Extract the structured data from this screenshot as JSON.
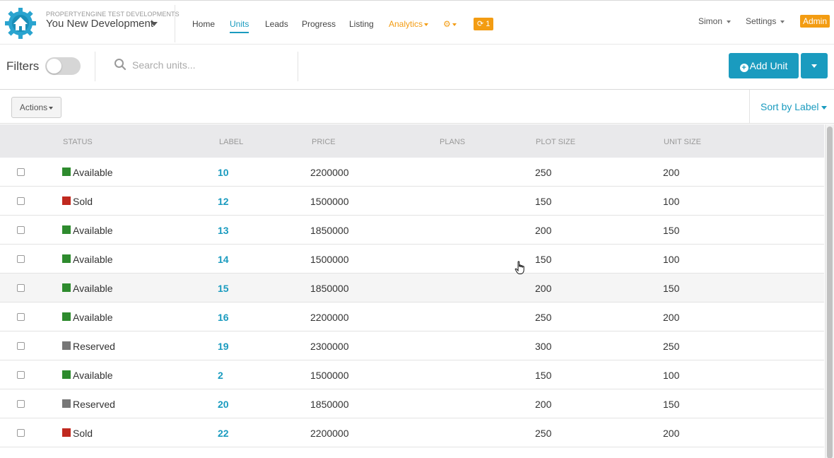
{
  "brand": {
    "subtitle": "PROPERTYENGINE TEST DEVELOPMENTS",
    "title": "You New Development"
  },
  "nav": {
    "items": [
      {
        "label": "Home"
      },
      {
        "label": "Units"
      },
      {
        "label": "Leads"
      },
      {
        "label": "Progress"
      },
      {
        "label": "Listing"
      }
    ],
    "analytics": "Analytics",
    "sync_count": "1",
    "user": "Simon",
    "settings": "Settings",
    "admin": "Admin"
  },
  "filters": {
    "label": "Filters",
    "search_placeholder": "Search units...",
    "add_unit": "Add Unit"
  },
  "toolbar": {
    "actions": "Actions",
    "sort": "Sort by Label"
  },
  "table": {
    "headers": [
      "STATUS",
      "LABEL",
      "PRICE",
      "PLANS",
      "PLOT SIZE",
      "UNIT SIZE"
    ],
    "rows": [
      {
        "status": "Available",
        "color": "#2e8b2e",
        "label": "10",
        "price": "2200000",
        "plans": "",
        "plot": "250",
        "unit": "200"
      },
      {
        "status": "Sold",
        "color": "#c0291f",
        "label": "12",
        "price": "1500000",
        "plans": "",
        "plot": "150",
        "unit": "100"
      },
      {
        "status": "Available",
        "color": "#2e8b2e",
        "label": "13",
        "price": "1850000",
        "plans": "",
        "plot": "200",
        "unit": "150"
      },
      {
        "status": "Available",
        "color": "#2e8b2e",
        "label": "14",
        "price": "1500000",
        "plans": "",
        "plot": "150",
        "unit": "100"
      },
      {
        "status": "Available",
        "color": "#2e8b2e",
        "label": "15",
        "price": "1850000",
        "plans": "",
        "plot": "200",
        "unit": "150"
      },
      {
        "status": "Available",
        "color": "#2e8b2e",
        "label": "16",
        "price": "2200000",
        "plans": "",
        "plot": "250",
        "unit": "200"
      },
      {
        "status": "Reserved",
        "color": "#777777",
        "label": "19",
        "price": "2300000",
        "plans": "",
        "plot": "300",
        "unit": "250"
      },
      {
        "status": "Available",
        "color": "#2e8b2e",
        "label": "2",
        "price": "1500000",
        "plans": "",
        "plot": "150",
        "unit": "100"
      },
      {
        "status": "Reserved",
        "color": "#777777",
        "label": "20",
        "price": "1850000",
        "plans": "",
        "plot": "200",
        "unit": "150"
      },
      {
        "status": "Sold",
        "color": "#c0291f",
        "label": "22",
        "price": "2200000",
        "plans": "",
        "plot": "250",
        "unit": "200"
      }
    ]
  },
  "colors": {
    "accent": "#1a9bbf",
    "warning": "#f39c12"
  }
}
